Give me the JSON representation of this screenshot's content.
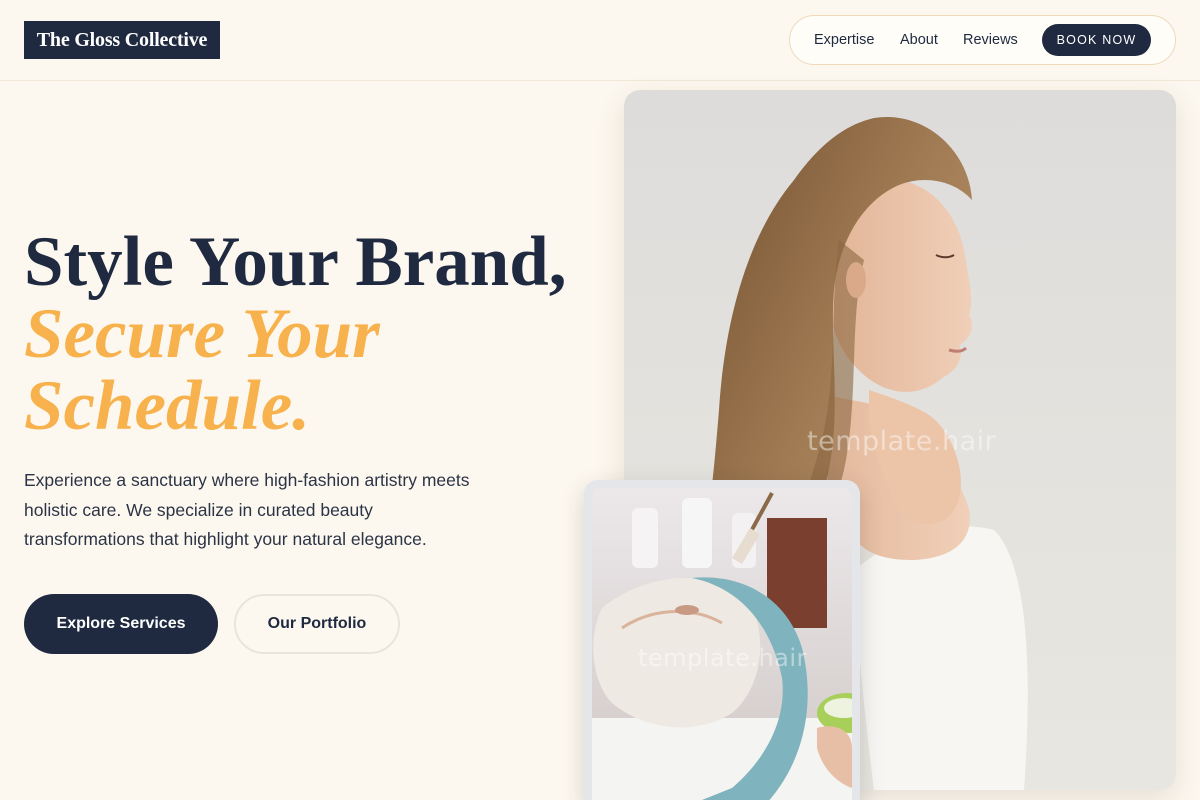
{
  "brand": {
    "name": "The Gloss Collective"
  },
  "nav": {
    "links": [
      "Expertise",
      "About",
      "Reviews"
    ],
    "cta": "BOOK NOW"
  },
  "hero": {
    "headline_line1": "Style Your Brand,",
    "headline_line2": "Secure Your",
    "headline_line3": "Schedule.",
    "description": "Experience a sanctuary where high-fashion artistry meets holistic care. We specialize in curated beauty transformations that highlight your natural elegance.",
    "primary_button": "Explore Services",
    "secondary_button": "Our Portfolio"
  },
  "images": {
    "main_watermark": "template.hair",
    "inset_watermark": "template.hair"
  },
  "colors": {
    "background": "#fdf8ef",
    "navy": "#1f2a40",
    "accent": "#f7b24d"
  }
}
